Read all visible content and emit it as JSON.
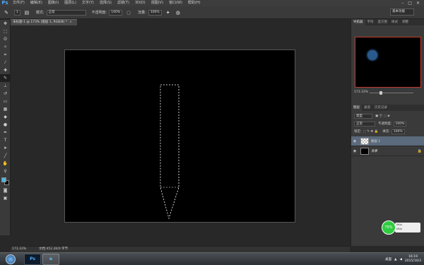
{
  "app": {
    "logo": "Ps"
  },
  "menu": [
    "文件(F)",
    "编辑(E)",
    "图像(I)",
    "图层(L)",
    "文字(Y)",
    "选择(S)",
    "滤镜(T)",
    "3D(D)",
    "视图(V)",
    "窗口(W)",
    "帮助(H)"
  ],
  "window_controls": {
    "minimize": "–",
    "restore": "□",
    "close": "✕"
  },
  "options": {
    "brush_size": "1",
    "mode_label": "模式:",
    "mode_value": "正常",
    "opacity_label": "不透明度:",
    "opacity_value": "100%",
    "flow_label": "流量:",
    "flow_value": "100%",
    "workspace": "基本功能"
  },
  "document": {
    "tab_title": "未标题-1 @ 173% (图层 1, RGB/8) *",
    "close": "×"
  },
  "status": {
    "zoom": "173.33%",
    "doc_info": "文档:452.2K/0 字节"
  },
  "navigator": {
    "tabs": [
      "导航器",
      "字符",
      "直方图",
      "样式",
      "调整"
    ],
    "zoom": "173.33%"
  },
  "layers": {
    "tabs": [
      "图层",
      "通道",
      "历史记录"
    ],
    "kind_filter": "类型",
    "blend_mode": "正常",
    "opacity_label": "不透明度:",
    "opacity_value": "100%",
    "lock_label": "锁定:",
    "fill_label": "填充:",
    "fill_value": "100%",
    "items": [
      {
        "name": "图层 1",
        "selected": true
      },
      {
        "name": "背景",
        "selected": false
      }
    ]
  },
  "widget": {
    "percent": "75%",
    "up": "0K/s",
    "down": "0K/s"
  },
  "taskbar": {
    "ps_label": "Ps",
    "ie_label": "e",
    "desktop_label": "桌面",
    "time": "16:19",
    "date": "2015/10/3"
  },
  "icons": {
    "eye": "eye-icon",
    "lock": "lock-icon",
    "colors": {
      "foreground": "#4bb8e8",
      "background": "#000000",
      "selection_layer": "#5b6a7c",
      "navigator_border": "#c0392b"
    }
  }
}
